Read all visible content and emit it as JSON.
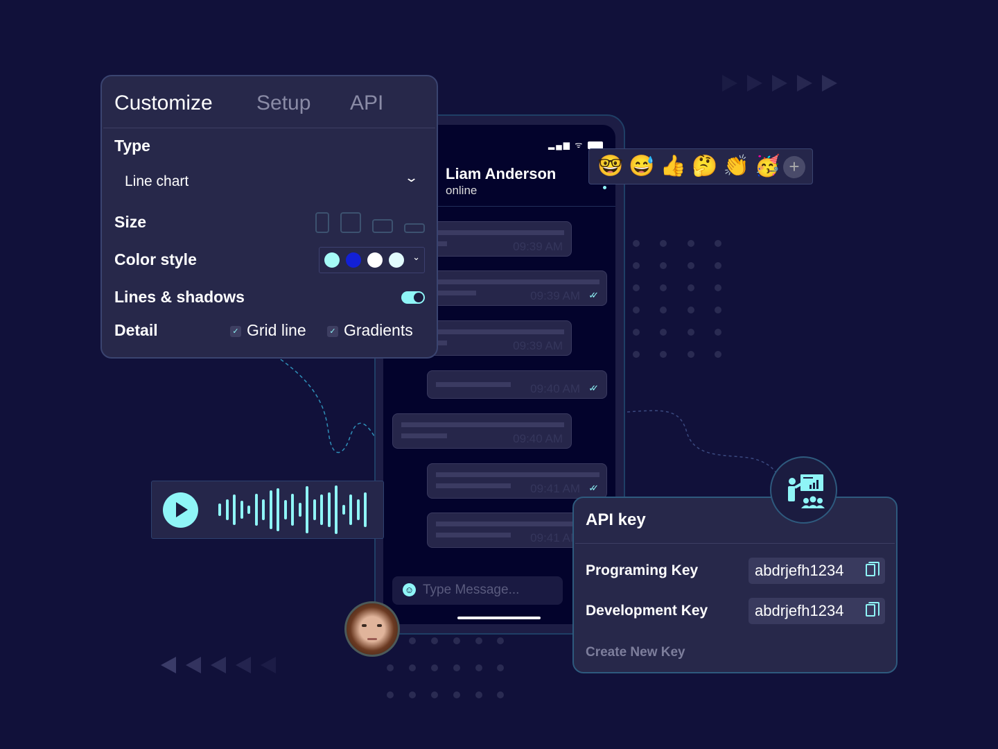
{
  "customize": {
    "tabs": [
      {
        "label": "Customize",
        "active": true
      },
      {
        "label": "Setup",
        "active": false
      },
      {
        "label": "API",
        "active": false
      }
    ],
    "type_label": "Type",
    "type_value": "Line chart",
    "size_label": "Size",
    "color_style_label": "Color style",
    "colors": [
      "#a6fbf7",
      "#1220d6",
      "#ffffff",
      "#e2fbfd"
    ],
    "lines_shadows_label": "Lines & shadows",
    "lines_shadows_on": true,
    "detail_label": "Detail",
    "grid_line_label": "Grid line",
    "grid_line_checked": true,
    "gradients_label": "Gradients",
    "gradients_checked": true
  },
  "chat": {
    "contact_name": "Liam Anderson",
    "contact_status": "online",
    "messages": [
      {
        "side": "in",
        "time": "09:39 AM"
      },
      {
        "side": "out",
        "time": "09:39 AM",
        "read": true
      },
      {
        "side": "in",
        "time": "09:39 AM"
      },
      {
        "side": "out",
        "time": "09:40 AM",
        "read": true
      },
      {
        "side": "in",
        "time": "09:40 AM"
      },
      {
        "side": "out",
        "time": "09:41 AM",
        "read": true
      },
      {
        "side": "out",
        "time": "09:41 AM"
      }
    ],
    "input_placeholder": "Type Message..."
  },
  "reactions": {
    "emojis": [
      "🤓",
      "😅",
      "👍",
      "🤔",
      "👏",
      "🥳"
    ],
    "add_label": "+"
  },
  "audio": {
    "icon": "play-icon"
  },
  "api": {
    "title": "API key",
    "keys": [
      {
        "label": "Programing Key",
        "value": "abdrjefh1234"
      },
      {
        "label": "Development Key",
        "value": "abdrjefh1234"
      }
    ],
    "create_label": "Create New Key"
  },
  "colors": {
    "accent": "#8ff5f7",
    "background": "#11113a",
    "panel": "#27284a"
  }
}
